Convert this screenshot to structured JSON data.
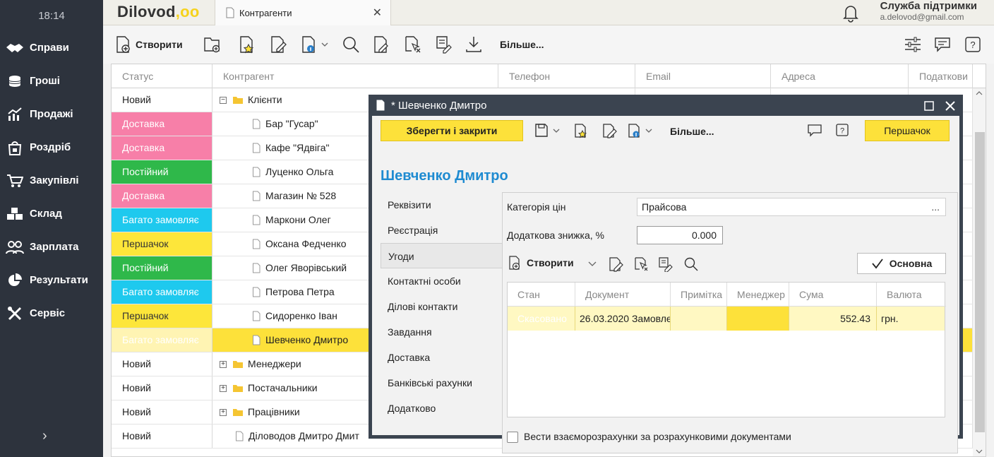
{
  "sidebar": {
    "time": "18:14",
    "items": [
      {
        "label": "Справи",
        "icon": "handshake-icon"
      },
      {
        "label": "Гроші",
        "icon": "coins-icon"
      },
      {
        "label": "Продажі",
        "icon": "sales-chart-icon"
      },
      {
        "label": "Роздріб",
        "icon": "shopping-bag-icon"
      },
      {
        "label": "Закупівлі",
        "icon": "cart-icon"
      },
      {
        "label": "Склад",
        "icon": "warehouse-boxes-icon"
      },
      {
        "label": "Зарплата",
        "icon": "people-icon"
      },
      {
        "label": "Результати",
        "icon": "pie-chart-icon"
      },
      {
        "label": "Сервіс",
        "icon": "tools-icon"
      }
    ],
    "expand": "›"
  },
  "topbar": {
    "logo": "Dilovod",
    "logo_dots": ",oo",
    "tab_title": "Контрагенти",
    "support_title": "Служба підтримки",
    "support_email": "a.delovod@gmail.com"
  },
  "toolbar": {
    "create_label": "Створити",
    "more_label": "Більше..."
  },
  "grid": {
    "columns": [
      "Статус",
      "Контрагент",
      "Телефон",
      "Email",
      "Адреса",
      "Податкови"
    ],
    "rows": [
      {
        "status": "Новий",
        "name": "Клієнти",
        "type": "folder",
        "expanded": true
      },
      {
        "status": "Доставка",
        "name": "Бар \"Гусар\"",
        "type": "doc"
      },
      {
        "status": "Доставка",
        "name": "Кафе \"Ядвіга\"",
        "type": "doc"
      },
      {
        "status": "Постійний",
        "name": "Луценко Ольга",
        "type": "doc"
      },
      {
        "status": "Доставка",
        "name": "Магазин № 528",
        "type": "doc"
      },
      {
        "status": "Багато замовляє",
        "name": "Маркони Олег",
        "type": "doc"
      },
      {
        "status": "Першачок",
        "name": "Оксана Федченко",
        "type": "doc"
      },
      {
        "status": "Постійний",
        "name": "Олег Яворівський",
        "type": "doc"
      },
      {
        "status": "Багато замовляє",
        "name": "Петрова Петра",
        "type": "doc"
      },
      {
        "status": "Першачок",
        "name": "Сидоренко Іван",
        "type": "doc"
      },
      {
        "status": "Багато замовляє",
        "name": "Шевченко Дмитро",
        "type": "doc",
        "selected": true
      },
      {
        "status": "Новий",
        "name": "Менеджери",
        "type": "folder"
      },
      {
        "status": "Новий",
        "name": "Постачальники",
        "type": "folder"
      },
      {
        "status": "Новий",
        "name": "Працівники",
        "type": "folder"
      },
      {
        "status": "Новий",
        "name": "Діловодов Дмитро Дмит",
        "type": "doc-root"
      }
    ],
    "status_colors": {
      "Новий": "#ffffff",
      "Доставка": "#f77fa8",
      "Постійний": "#2fb84a",
      "Багато замовляє": "#1ec9ee",
      "Першачок": "#fde63a"
    }
  },
  "dialog": {
    "title": "* Шевченко Дмитро",
    "save_close": "Зберегти і закрити",
    "more": "Більше...",
    "status_button": "Першачок",
    "heading": "Шевченко Дмитро",
    "menu": [
      "Реквізити",
      "Реєстрація",
      "Угоди",
      "Контактні особи",
      "Ділові контакти",
      "Завдання",
      "Доставка",
      "Банківські рахунки",
      "Додатково"
    ],
    "active_menu": "Угоди",
    "price_category_label": "Категорія цін",
    "price_category_value": "Прайсова",
    "price_category_more": "...",
    "discount_label": "Додаткова знижка, %",
    "discount_value": "0.000",
    "create_label": "Створити",
    "main_label": "Основна",
    "sub_columns": [
      "Стан",
      "Документ",
      "Примітка",
      "Менеджер",
      "Сума",
      "Валюта"
    ],
    "sub_rows": [
      {
        "state": "Скасовано",
        "document": "26.03.2020 Замовле",
        "note": "",
        "manager": "",
        "sum": "552.43",
        "currency": "грн."
      }
    ],
    "checkbox_label": "Вести взаєморозрахунки за розрахунковими документами"
  }
}
